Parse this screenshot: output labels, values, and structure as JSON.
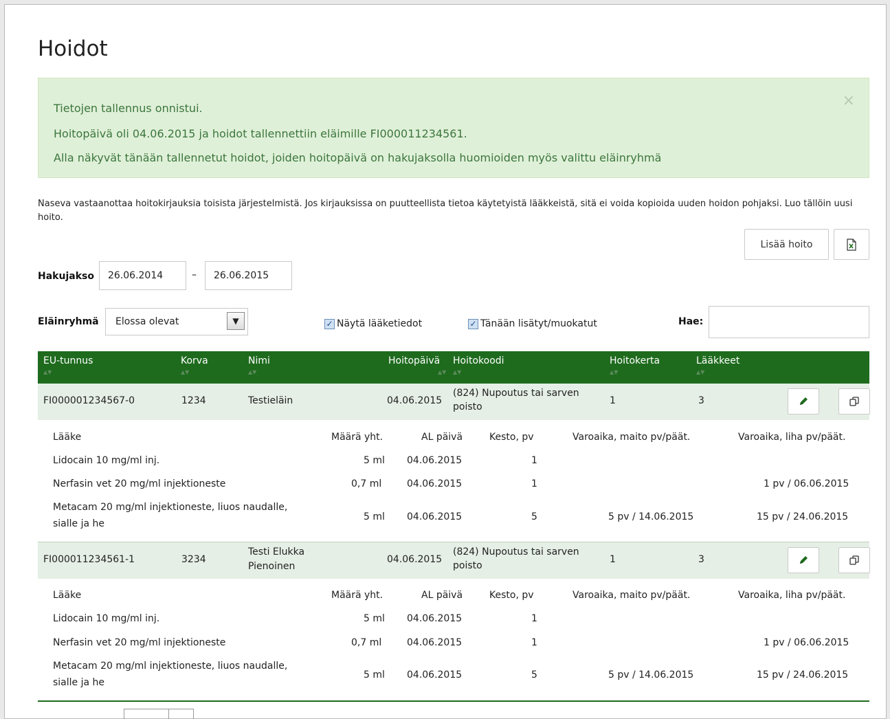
{
  "page": {
    "title": "Hoidot"
  },
  "alert": {
    "lines": [
      "Tietojen tallennus onnistui.",
      "Hoitopäivä oli 04.06.2015 ja hoidot tallennettiin eläimille FI000011234561.",
      "Alla näkyvät tänään tallennetut hoidot, joiden hoitopäivä on hakujaksolla huomioiden myös valittu eläinryhmä"
    ],
    "close": "×"
  },
  "info_text": "Naseva vastaanottaa hoitokirjauksia toisista järjestelmistä. Jos kirjauksissa on puutteellista tietoa käytetyistä lääkkeistä, sitä ei voida kopioida uuden hoidon pohjaksi. Luo tällöin uusi hoito.",
  "toolbar": {
    "add_label": "Lisää hoito",
    "export_icon": "excel-export-icon"
  },
  "filters": {
    "period_label": "Hakujakso",
    "start": "26.06.2014",
    "separator": "–",
    "end": "26.06.2015",
    "group_label": "Eläinryhmä",
    "group_value": "Elossa olevat",
    "show_medicines_label": "Näytä lääketiedot",
    "show_medicines_checked": true,
    "today_label": "Tänään lisätyt/muokatut",
    "today_checked": true,
    "search_label": "Hae:",
    "search_value": ""
  },
  "table": {
    "sort_glyph": "▲▼",
    "headers": [
      "EU-tunnus",
      "Korva",
      "Nimi",
      "Hoitopäivä",
      "Hoitokoodi",
      "Hoitokerta",
      "Lääkkeet"
    ],
    "sub_headers": [
      "Lääke",
      "Määrä yht.",
      "AL päivä",
      "Kesto, pv",
      "Varoaika, maito pv/päät.",
      "Varoaika, liha pv/päät."
    ],
    "rows": [
      {
        "eu": "FI000001234567-0",
        "korva": "1234",
        "nimi_1": "Testieläin",
        "nimi_2": "",
        "date": "04.06.2015",
        "code_1": "(824) Nupoutus tai sarven",
        "code_2": "poisto",
        "kerta": "1",
        "laakkeet": "3",
        "medicines": [
          {
            "name_1": "Lidocain 10 mg/ml inj.",
            "name_2": "",
            "amount": "5 ml",
            "al": "04.06.2015",
            "kesto": "1",
            "maito": "",
            "liha": ""
          },
          {
            "name_1": "Nerfasin vet 20 mg/ml injektioneste",
            "name_2": "",
            "amount": "0,7 ml",
            "al": "04.06.2015",
            "kesto": "1",
            "maito": "",
            "liha": "1 pv / 06.06.2015"
          },
          {
            "name_1": "Metacam 20 mg/ml injektioneste, liuos naudalle,",
            "name_2": "sialle ja he",
            "amount": "5 ml",
            "al": "04.06.2015",
            "kesto": "5",
            "maito": "5 pv / 14.06.2015",
            "liha": "15 pv / 24.06.2015"
          }
        ]
      },
      {
        "eu": "FI000011234561-1",
        "korva": "3234",
        "nimi_1": "Testi Elukka",
        "nimi_2": "Pienoinen",
        "date": "04.06.2015",
        "code_1": "(824) Nupoutus tai sarven",
        "code_2": "poisto",
        "kerta": "1",
        "laakkeet": "3",
        "medicines": [
          {
            "name_1": "Lidocain 10 mg/ml inj.",
            "name_2": "",
            "amount": "5 ml",
            "al": "04.06.2015",
            "kesto": "1",
            "maito": "",
            "liha": ""
          },
          {
            "name_1": "Nerfasin vet 20 mg/ml injektioneste",
            "name_2": "",
            "amount": "0,7 ml",
            "al": "04.06.2015",
            "kesto": "1",
            "maito": "",
            "liha": "1 pv / 06.06.2015"
          },
          {
            "name_1": "Metacam 20 mg/ml injektioneste, liuos naudalle,",
            "name_2": "sialle ja he",
            "amount": "5 ml",
            "al": "04.06.2015",
            "kesto": "5",
            "maito": "5 pv / 14.06.2015",
            "liha": "15 pv / 24.06.2015"
          }
        ]
      }
    ]
  },
  "icons": {
    "edit": "pencil-icon",
    "copy": "copy-icon",
    "close": "close-icon"
  },
  "colors": {
    "header_green": "#1e6b1e",
    "alert_bg": "#dff0d8",
    "alert_text": "#3c763d",
    "row_bg": "#e6efe6"
  }
}
